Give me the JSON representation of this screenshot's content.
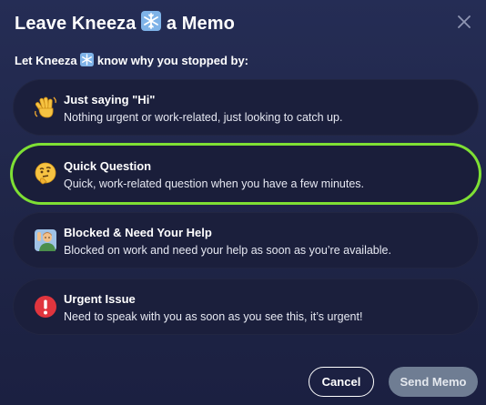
{
  "dialog": {
    "title_prefix": "Leave Kneeza",
    "title_suffix": "a Memo",
    "subtitle_prefix": "Let Kneeza",
    "subtitle_suffix": "know why you stopped by:",
    "close_icon": "close-icon"
  },
  "options": [
    {
      "icon": "waving-hand-icon",
      "title": "Just saying \"Hi\"",
      "description": "Nothing urgent or work-related, just looking to catch up.",
      "selected": false
    },
    {
      "icon": "thinking-face-icon",
      "title": "Quick Question",
      "description": "Quick, work-related question when you have a few minutes.",
      "selected": true
    },
    {
      "icon": "person-raising-hand-icon",
      "title": "Blocked & Need Your Help",
      "description": "Blocked on work and need your help as soon as you’re available.",
      "selected": false
    },
    {
      "icon": "exclamation-circle-icon",
      "title": "Urgent Issue",
      "description": "Need to speak with you as soon as you see this, it’s urgent!",
      "selected": false
    }
  ],
  "actions": {
    "cancel_label": "Cancel",
    "send_label": "Send Memo"
  },
  "colors": {
    "selection_outline": "#7ee034",
    "send_button_disabled": "#6f7d93",
    "option_background": "#1b1f3c"
  }
}
